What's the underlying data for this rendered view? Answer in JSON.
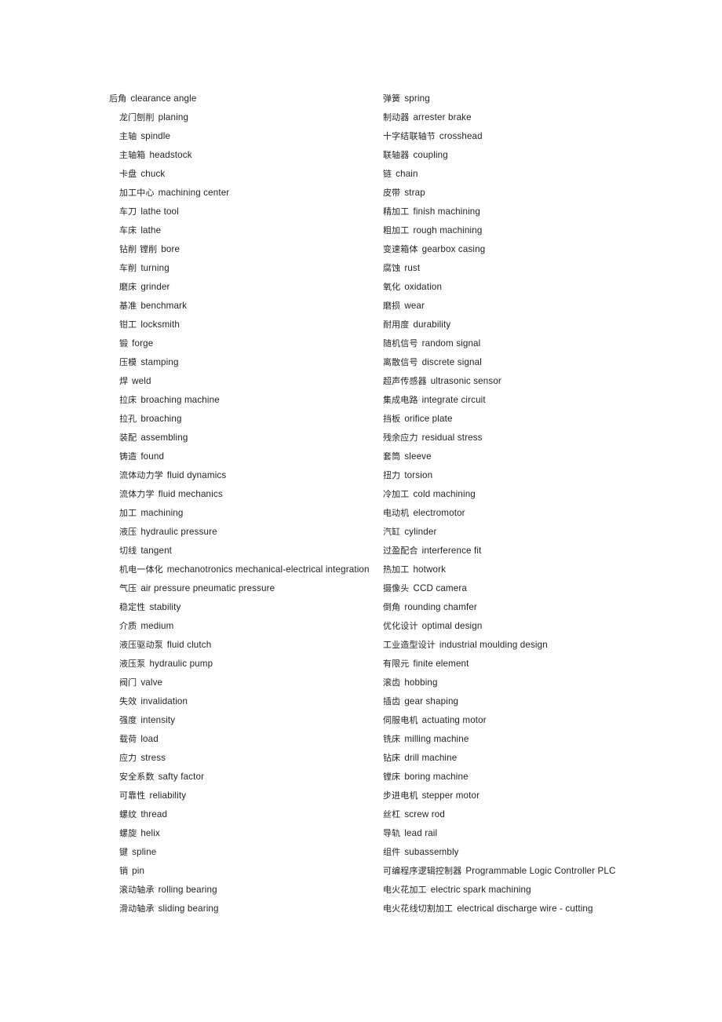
{
  "document": {
    "type": "bilingual-glossary",
    "subject": "Mechanical engineering Chinese-English terminology list",
    "background_color": "#ffffff",
    "text_color": "#1f1f1f"
  },
  "columns": {
    "left": {
      "name": "left-column",
      "entries": [
        {
          "cn": "后角",
          "en": "clearance angle",
          "indent": false
        },
        {
          "cn": "龙门刨削",
          "en": "planing",
          "indent": true
        },
        {
          "cn": "主轴",
          "en": "spindle",
          "indent": true
        },
        {
          "cn": "主轴箱",
          "en": "headstock",
          "indent": true
        },
        {
          "cn": "卡盘",
          "en": "chuck",
          "indent": true
        },
        {
          "cn": "加工中心",
          "en": "machining center",
          "indent": true
        },
        {
          "cn": "车刀",
          "en": "lathe tool",
          "indent": true
        },
        {
          "cn": "车床",
          "en": "lathe",
          "indent": true
        },
        {
          "cn": "钻削 镗削",
          "en": "bore",
          "indent": true
        },
        {
          "cn": "车削",
          "en": "turning",
          "indent": true
        },
        {
          "cn": "磨床",
          "en": "grinder",
          "indent": true
        },
        {
          "cn": "基准",
          "en": "benchmark",
          "indent": true
        },
        {
          "cn": "钳工",
          "en": "locksmith",
          "indent": true
        },
        {
          "cn": "锻",
          "en": "forge",
          "indent": true
        },
        {
          "cn": "压模",
          "en": "stamping",
          "indent": true
        },
        {
          "cn": "焊",
          "en": "weld",
          "indent": true
        },
        {
          "cn": "拉床",
          "en": "broaching machine",
          "indent": true
        },
        {
          "cn": "拉孔",
          "en": "broaching",
          "indent": true
        },
        {
          "cn": "装配",
          "en": "assembling",
          "indent": true
        },
        {
          "cn": "铸造",
          "en": "found",
          "indent": true
        },
        {
          "cn": "流体动力学",
          "en": "fluid dynamics",
          "indent": true
        },
        {
          "cn": "流体力学",
          "en": "fluid mechanics",
          "indent": true
        },
        {
          "cn": "加工",
          "en": "machining",
          "indent": true
        },
        {
          "cn": "液压",
          "en": "hydraulic pressure",
          "indent": true
        },
        {
          "cn": "切线",
          "en": "tangent",
          "indent": true
        },
        {
          "cn": "机电一体化",
          "en": "mechanotronics mechanical-electrical integration",
          "indent": true
        },
        {
          "cn": "气压",
          "en": "air pressure pneumatic pressure",
          "indent": true
        },
        {
          "cn": "稳定性",
          "en": "stability",
          "indent": true
        },
        {
          "cn": "介质",
          "en": "medium",
          "indent": true
        },
        {
          "cn": "液压驱动泵",
          "en": "fluid clutch",
          "indent": true
        },
        {
          "cn": "液压泵",
          "en": "hydraulic pump",
          "indent": true
        },
        {
          "cn": "阀门",
          "en": "valve",
          "indent": true
        },
        {
          "cn": "失效",
          "en": "invalidation",
          "indent": true
        },
        {
          "cn": "强度",
          "en": "intensity",
          "indent": true
        },
        {
          "cn": "载荷",
          "en": "load",
          "indent": true
        },
        {
          "cn": "应力",
          "en": "stress",
          "indent": true
        },
        {
          "cn": "安全系数",
          "en": "safty factor",
          "indent": true
        },
        {
          "cn": "可靠性",
          "en": "reliability",
          "indent": true
        },
        {
          "cn": "螺纹",
          "en": "thread",
          "indent": true
        },
        {
          "cn": "螺旋",
          "en": "helix",
          "indent": true
        },
        {
          "cn": "键",
          "en": "spline",
          "indent": true
        },
        {
          "cn": "销",
          "en": "pin",
          "indent": true
        },
        {
          "cn": "滚动轴承",
          "en": "rolling bearing",
          "indent": true
        },
        {
          "cn": "滑动轴承",
          "en": "sliding bearing",
          "indent": true
        }
      ]
    },
    "right": {
      "name": "right-column",
      "entries": [
        {
          "cn": "弹簧",
          "en": "spring"
        },
        {
          "cn": "制动器",
          "en": "arrester brake"
        },
        {
          "cn": "十字结联轴节",
          "en": "crosshead"
        },
        {
          "cn": "联轴器",
          "en": "coupling"
        },
        {
          "cn": "链",
          "en": "chain"
        },
        {
          "cn": "皮带",
          "en": "strap"
        },
        {
          "cn": "精加工",
          "en": "finish machining"
        },
        {
          "cn": "粗加工",
          "en": "rough machining"
        },
        {
          "cn": "变速箱体",
          "en": "gearbox casing"
        },
        {
          "cn": "腐蚀",
          "en": "rust"
        },
        {
          "cn": "氧化",
          "en": "oxidation"
        },
        {
          "cn": "磨损",
          "en": "wear"
        },
        {
          "cn": "耐用度",
          "en": "durability"
        },
        {
          "cn": "随机信号",
          "en": "random signal"
        },
        {
          "cn": "离散信号",
          "en": "discrete signal"
        },
        {
          "cn": "超声传感器",
          "en": "ultrasonic sensor"
        },
        {
          "cn": "集成电路",
          "en": "integrate circuit"
        },
        {
          "cn": "挡板",
          "en": "orifice plate"
        },
        {
          "cn": "残余应力",
          "en": "residual stress"
        },
        {
          "cn": "套筒",
          "en": "sleeve"
        },
        {
          "cn": "扭力",
          "en": "torsion"
        },
        {
          "cn": "冷加工",
          "en": "cold machining"
        },
        {
          "cn": "电动机",
          "en": "electromotor"
        },
        {
          "cn": "汽缸",
          "en": "cylinder"
        },
        {
          "cn": "过盈配合",
          "en": "interference fit"
        },
        {
          "cn": "热加工",
          "en": "hotwork"
        },
        {
          "cn": "摄像头",
          "en": "CCD camera"
        },
        {
          "cn": "倒角",
          "en": "rounding chamfer"
        },
        {
          "cn": "优化设计",
          "en": "optimal design"
        },
        {
          "cn": "工业造型设计",
          "en": "industrial moulding design"
        },
        {
          "cn": "有限元",
          "en": "finite element"
        },
        {
          "cn": "滚齿",
          "en": "hobbing"
        },
        {
          "cn": "插齿",
          "en": "gear shaping"
        },
        {
          "cn": "伺服电机",
          "en": "actuating motor"
        },
        {
          "cn": "铣床",
          "en": "milling machine"
        },
        {
          "cn": "钻床",
          "en": "drill machine"
        },
        {
          "cn": "镗床",
          "en": "boring machine"
        },
        {
          "cn": "步进电机",
          "en": "stepper motor"
        },
        {
          "cn": "丝杠",
          "en": "screw rod"
        },
        {
          "cn": "导轨",
          "en": "lead rail"
        },
        {
          "cn": "组件",
          "en": "subassembly"
        },
        {
          "cn": "可编程序逻辑控制器",
          "en": "Programmable Logic Controller PLC"
        },
        {
          "cn": "电火花加工",
          "en": "electric spark machining"
        },
        {
          "cn": "电火花线切割加工",
          "en": "electrical discharge wire - cutting"
        }
      ]
    }
  }
}
